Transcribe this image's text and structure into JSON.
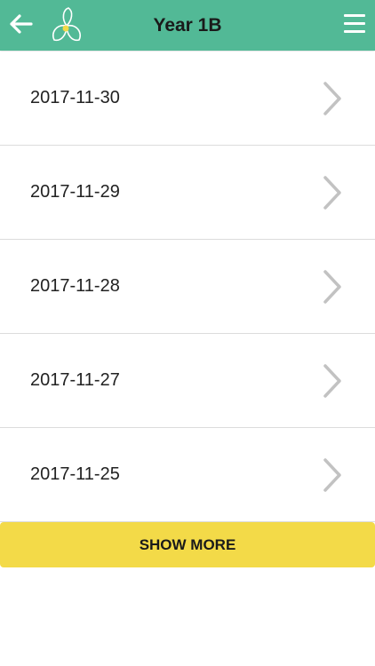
{
  "header": {
    "title": "Year 1B",
    "back_icon": "arrow-left-icon",
    "logo_icon": "leaf-logo-icon",
    "menu_icon": "hamburger-menu-icon",
    "background_color": "#52b996"
  },
  "list": {
    "items": [
      {
        "label": "2017-11-30"
      },
      {
        "label": "2017-11-29"
      },
      {
        "label": "2017-11-28"
      },
      {
        "label": "2017-11-27"
      },
      {
        "label": "2017-11-25"
      }
    ],
    "chevron_icon": "chevron-right-icon"
  },
  "footer": {
    "show_more_label": "SHOW MORE",
    "show_more_color": "#f3da48"
  }
}
